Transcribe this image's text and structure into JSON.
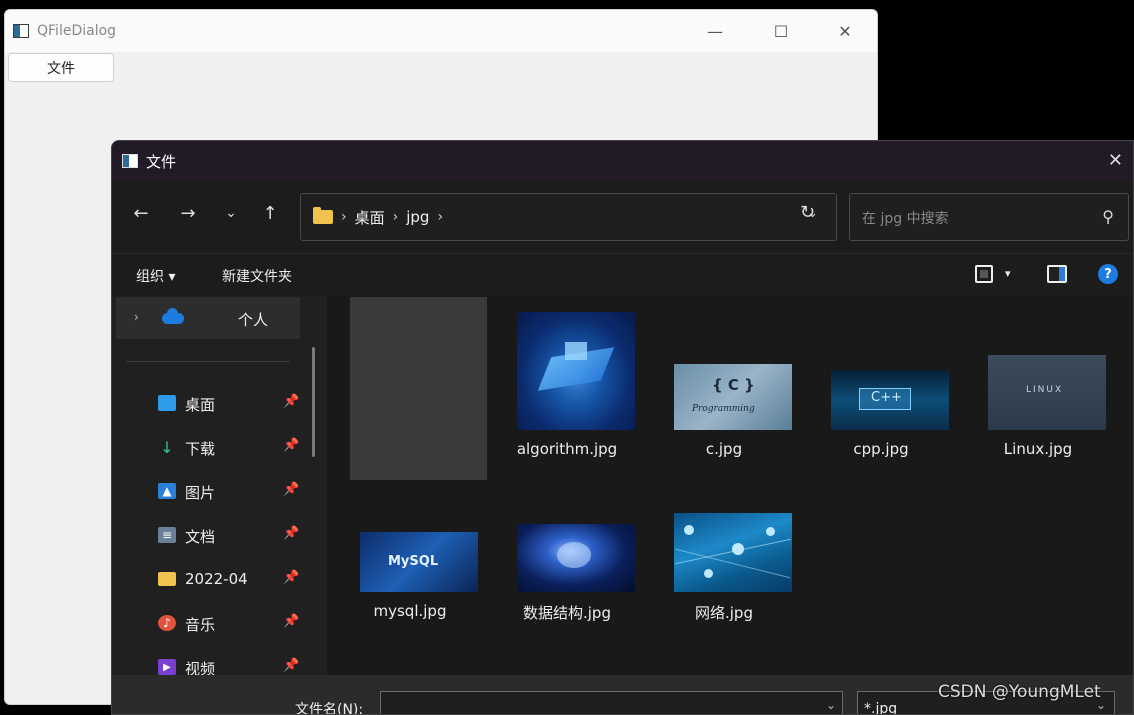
{
  "main_window": {
    "title": "QFileDialog",
    "caption": {
      "minimize": "—",
      "maximize": "☐",
      "close": "✕"
    },
    "button_label": "文件"
  },
  "dialog": {
    "title": "文件",
    "close": "✕",
    "nav": {
      "back": "←",
      "forward": "→",
      "recent": "⌄",
      "up": "↑"
    },
    "address": {
      "crumbs": [
        "桌面",
        "jpg"
      ],
      "separator": "›",
      "dropdown": "⌄",
      "refresh": "↻"
    },
    "search": {
      "placeholder": "在 jpg 中搜索",
      "icon": "⚲"
    },
    "toolbar": {
      "organize": "组织 ▾",
      "new_folder": "新建文件夹",
      "view_dropdown": "▾",
      "help": "?"
    },
    "nav_pane": {
      "top_item": {
        "chevron": "›",
        "label": "个人"
      },
      "items": [
        {
          "label": "桌面",
          "icon": "desktop-icon",
          "color": "#2d9be8",
          "glyph": "",
          "pin": "📌"
        },
        {
          "label": "下载",
          "icon": "download-icon",
          "color": "transparent",
          "glyph": "↓",
          "pin": "📌"
        },
        {
          "label": "图片",
          "icon": "pictures-icon",
          "color": "#2a7fd8",
          "glyph": "▲",
          "pin": "📌"
        },
        {
          "label": "文档",
          "icon": "documents-icon",
          "color": "#6b7f99",
          "glyph": "≡",
          "pin": "📌"
        },
        {
          "label": "2022-04",
          "icon": "folder-icon",
          "color": "#f0c24e",
          "glyph": "",
          "pin": "📌"
        },
        {
          "label": "音乐",
          "icon": "music-icon",
          "color": "#e0533d",
          "glyph": "♪",
          "pin": "📌"
        },
        {
          "label": "视频",
          "icon": "videos-icon",
          "color": "#7a3fd0",
          "glyph": "▶",
          "pin": "📌"
        }
      ]
    },
    "files": [
      {
        "name": "algorithm.jpg",
        "overlay": ""
      },
      {
        "name": "c.jpg",
        "overlay": "{ C }"
      },
      {
        "name": "cpp.jpg",
        "overlay": "C++"
      },
      {
        "name": "Linux.jpg",
        "overlay": "LINUX"
      },
      {
        "name": "mysql.jpg",
        "overlay": "MySQL"
      },
      {
        "name": "数据结构.jpg",
        "overlay": ""
      },
      {
        "name": "网络.jpg",
        "overlay": ""
      }
    ],
    "footer": {
      "filename_label": "文件名(N):",
      "filename_value": "",
      "filter_value": "*.jpg",
      "dropdown": "⌄"
    }
  },
  "watermark": "CSDN @YoungMLet"
}
